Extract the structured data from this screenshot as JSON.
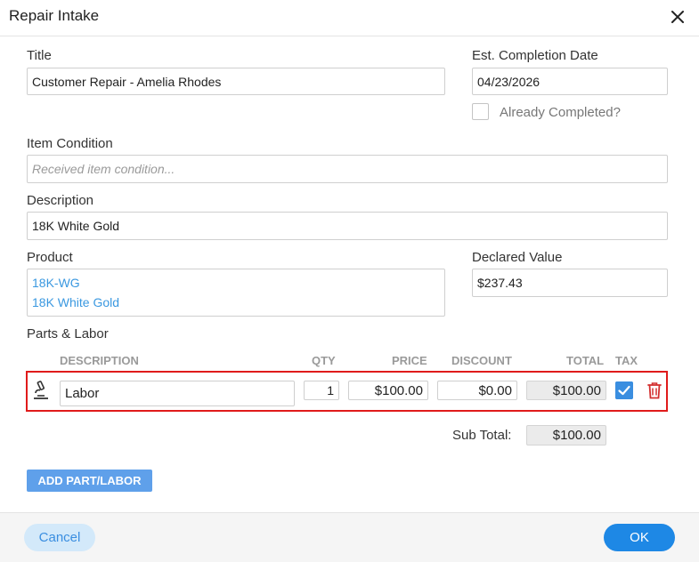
{
  "dialog": {
    "title": "Repair Intake"
  },
  "form": {
    "title_label": "Title",
    "title_value": "Customer Repair - Amelia Rhodes",
    "date_label": "Est. Completion Date",
    "date_value": "04/23/2026",
    "completed_label": "Already Completed?",
    "completed_checked": false,
    "condition_label": "Item Condition",
    "condition_placeholder": "Received item condition...",
    "condition_value": "",
    "description_label": "Description",
    "description_value": "18K White Gold",
    "product_label": "Product",
    "product_lines": [
      "18K-WG",
      "18K White Gold"
    ],
    "declared_label": "Declared Value",
    "declared_value": "$237.43"
  },
  "parts": {
    "section_label": "Parts & Labor",
    "columns": {
      "description": "DESCRIPTION",
      "qty": "QTY",
      "price": "PRICE",
      "discount": "DISCOUNT",
      "total": "TOTAL",
      "tax": "TAX"
    },
    "rows": [
      {
        "description": "Labor",
        "qty": "1",
        "price": "$100.00",
        "discount": "$0.00",
        "total": "$100.00",
        "tax": true,
        "icon": "wrench-icon"
      }
    ],
    "subtotal_label": "Sub Total:",
    "subtotal_value": "$100.00",
    "add_button": "ADD PART/LABOR"
  },
  "footer": {
    "cancel_label": "Cancel",
    "ok_label": "OK"
  },
  "colors": {
    "accent": "#1e88e5",
    "link": "#3a98e0",
    "highlight_border": "#e01b1b",
    "delete": "#d32f2f"
  }
}
